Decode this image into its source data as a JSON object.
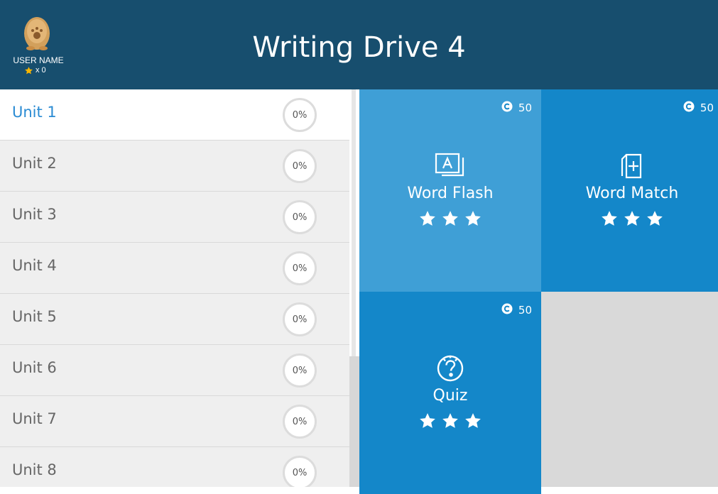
{
  "header": {
    "title": "Writing Drive 4",
    "user_name": "USER NAME",
    "star_count": "x 0"
  },
  "units": [
    {
      "label": "Unit 1",
      "progress": "0%",
      "active": true
    },
    {
      "label": "Unit 2",
      "progress": "0%"
    },
    {
      "label": "Unit 3",
      "progress": "0%"
    },
    {
      "label": "Unit 4",
      "progress": "0%"
    },
    {
      "label": "Unit 5",
      "progress": "0%"
    },
    {
      "label": "Unit 6",
      "progress": "0%"
    },
    {
      "label": "Unit 7",
      "progress": "0%"
    },
    {
      "label": "Unit 8",
      "progress": "0%"
    }
  ],
  "activities": [
    {
      "label": "Word Flash",
      "coins": "50",
      "stars": 3,
      "icon": "flashcard-icon",
      "color": "#3f9fd6"
    },
    {
      "label": "Word Match",
      "coins": "50",
      "stars": 3,
      "icon": "card-add-icon",
      "color": "#1487c9"
    },
    {
      "label": "Quiz",
      "coins": "50",
      "stars": 3,
      "icon": "question-icon",
      "color": "#1487c9"
    }
  ],
  "colors": {
    "header_bg": "#174e6e",
    "active_unit_text": "#2a8bd3",
    "star_gold": "#f7b500"
  }
}
